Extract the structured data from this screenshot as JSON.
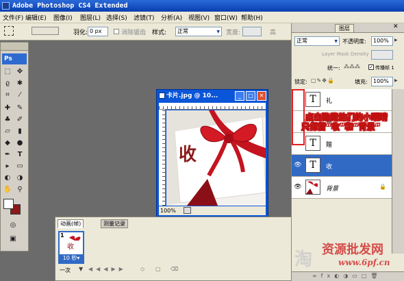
{
  "app": {
    "title": "Adobe Photoshop CS4 Extended"
  },
  "menu": [
    "文件(F)",
    "编辑(E)",
    "图像(I)",
    "图层(L)",
    "选择(S)",
    "滤镜(T)",
    "分析(A)",
    "视图(V)",
    "窗口(W)",
    "帮助(H)"
  ],
  "options": {
    "feather_label": "羽化:",
    "feather_value": "0 px",
    "antialias_label": "消除锯齿",
    "style_label": "样式:",
    "style_value": "正常",
    "width_label": "宽度:",
    "height_label": "高"
  },
  "toolbox": {
    "badge": "Ps"
  },
  "document": {
    "title": "卡片.jpg @ 10...",
    "zoom": "100%",
    "canvas_text": "收"
  },
  "animation": {
    "tabs": [
      "动画(帧)",
      "测量记录"
    ],
    "frame_number": "1",
    "frame_delay": "10 秒▾",
    "loop": "一次"
  },
  "layers": {
    "tab": "图层",
    "blend_mode": "正常",
    "opacity_label": "不透明度:",
    "opacity": "100%",
    "mask_density": "Layer Mask Density",
    "unify_label": "统一:",
    "propagate_label": "传播帧 1",
    "lock_label": "锁定:",
    "fill_label": "填充:",
    "fill": "100%",
    "items": [
      {
        "name": "礼",
        "type": "text",
        "visible": false
      },
      {
        "name": "賀",
        "type": "text",
        "visible": false
      },
      {
        "name": "贈",
        "type": "text",
        "visible": false
      },
      {
        "name": "收",
        "type": "text",
        "visible": true,
        "selected": true
      },
      {
        "name": "背景",
        "type": "image",
        "visible": true
      }
    ]
  },
  "annotation": {
    "line1": "点击隐藏他们的小眼睛",
    "line2": "只保留“收”和“背景”"
  },
  "watermark": {
    "site_cn": "资源批发网",
    "site_url": "www.6pf.cn",
    "tao": "淘"
  }
}
